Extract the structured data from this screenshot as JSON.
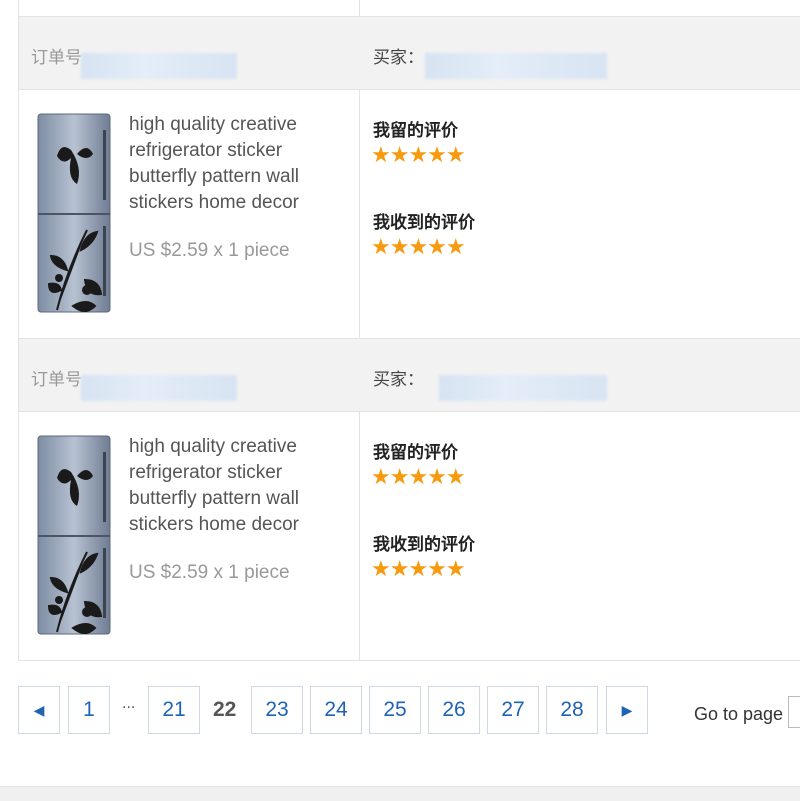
{
  "orders": [
    {
      "order_label": "订单号",
      "buyer_label": "买家：",
      "product": {
        "title": "high quality creative refrigerator sticker butterfly pattern wall stickers home decor",
        "price": "US $2.59 x 1 piece"
      },
      "given_review_label": "我留的评价",
      "received_review_label": "我收到的评价",
      "given_stars": "★★★★★",
      "received_stars": "★★★★★"
    },
    {
      "order_label": "订单号",
      "buyer_label": "买家：",
      "product": {
        "title": "high quality creative refrigerator sticker butterfly pattern wall stickers home decor",
        "price": "US $2.59 x 1 piece"
      },
      "given_review_label": "我留的评价",
      "received_review_label": "我收到的评价",
      "given_stars": "★★★★★",
      "received_stars": "★★★★★"
    }
  ],
  "rating": {
    "given": 5,
    "received": 5,
    "max": 5
  },
  "pagination": {
    "prev_icon": "◀",
    "next_icon": "▶",
    "first": "1",
    "ellipsis": "...",
    "pages_before": [
      "21"
    ],
    "current": "22",
    "pages_after": [
      "23",
      "24",
      "25",
      "26",
      "27",
      "28"
    ],
    "goto_label": "Go to page"
  },
  "colors": {
    "star": "#f79a0e",
    "link": "#1f63b4",
    "header_bg": "#f2f2f2"
  }
}
